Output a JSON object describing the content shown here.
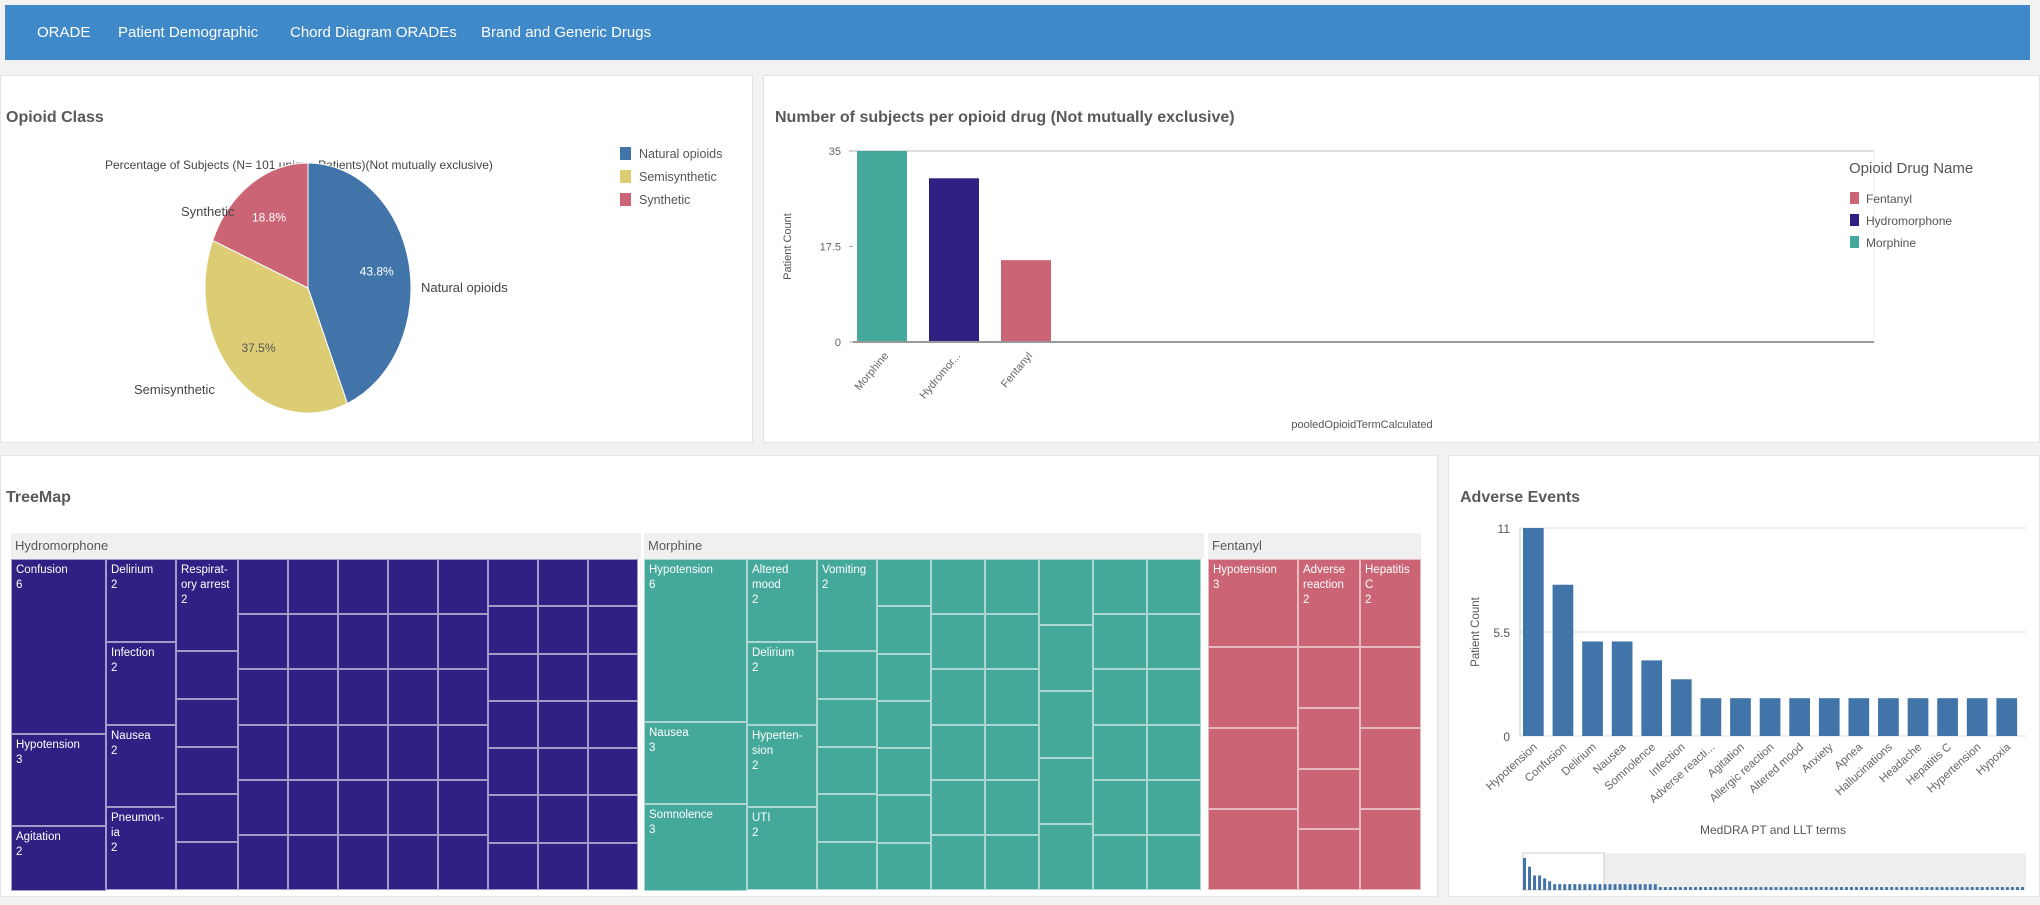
{
  "nav": {
    "tabs": [
      "ORADE",
      "Patient Demographic",
      "Chord Diagram ORADEs",
      "Brand and Generic Drugs"
    ],
    "color": "#3f89c9"
  },
  "opioid_class": {
    "title": "Opioid Class",
    "chart_data": {
      "type": "pie",
      "subtitle": "Percentage of Subjects (N= 101 unique Patients)(Not mutually exclusive)",
      "slices": [
        {
          "label": "Natural opioids",
          "value": 43.8,
          "display": "43.8%",
          "color": "#4174a8"
        },
        {
          "label": "Semisynthetic",
          "value": 37.5,
          "display": "37.5%",
          "color": "#dccd75"
        },
        {
          "label": "Synthetic",
          "value": 18.8,
          "display": "18.8%",
          "color": "#cb6474"
        }
      ],
      "legend": [
        "Natural opioids",
        "Semisynthetic",
        "Synthetic"
      ],
      "legend_placement": "right"
    }
  },
  "drug_chart": {
    "title": "Number of subjects per opioid drug (Not mutually exclusive)",
    "chart_data": {
      "type": "bar",
      "categories": [
        "Morphine",
        "Hydromor...",
        "Fentanyl"
      ],
      "values": [
        35,
        30,
        15
      ],
      "colors": [
        "#44a99a",
        "#312083",
        "#cb6474"
      ],
      "xlabel": "pooledOpioidTermCalculated",
      "ylabel": "Patient Count",
      "yticks": [
        "0",
        "17.5",
        "35"
      ],
      "ylim": [
        0,
        35
      ],
      "legend_title": "Opioid Drug Name",
      "legend": [
        {
          "name": "Fentanyl",
          "color": "#cb6474"
        },
        {
          "name": "Hydromorphone",
          "color": "#312083"
        },
        {
          "name": "Morphine",
          "color": "#44a99a"
        }
      ],
      "legend_placement": "right"
    }
  },
  "treemap": {
    "title": "TreeMap",
    "groups": [
      {
        "name": "Hydromorphone",
        "color": "#312083",
        "cells": [
          {
            "label": "Confusion",
            "value": "6"
          },
          {
            "label": "Hypotension",
            "value": "3"
          },
          {
            "label": "Agitation",
            "value": "2"
          },
          {
            "label": "Delirium",
            "value": "2"
          },
          {
            "label": "Infection",
            "value": "2"
          },
          {
            "label": "Nausea",
            "value": "2"
          },
          {
            "label": "Pneumon-ia",
            "value": "2"
          },
          {
            "label": "Respirat-ory arrest",
            "value": "2"
          }
        ]
      },
      {
        "name": "Morphine",
        "color": "#44a99a",
        "cells": [
          {
            "label": "Hypotension",
            "value": "6"
          },
          {
            "label": "Nausea",
            "value": "3"
          },
          {
            "label": "Somnolence",
            "value": "3"
          },
          {
            "label": "Altered mood",
            "value": "2"
          },
          {
            "label": "Delirium",
            "value": "2"
          },
          {
            "label": "Hyperten-sion",
            "value": "2"
          },
          {
            "label": "UTI",
            "value": "2"
          },
          {
            "label": "Vomiting",
            "value": "2"
          }
        ]
      },
      {
        "name": "Fentanyl",
        "color": "#cb6474",
        "cells": [
          {
            "label": "Hypotension",
            "value": "3"
          },
          {
            "label": "Adverse reaction",
            "value": "2"
          },
          {
            "label": "Hepatitis C",
            "value": "2"
          }
        ]
      }
    ]
  },
  "adverse_events": {
    "title": "Adverse Events",
    "chart_data": {
      "type": "bar",
      "categories": [
        "Hypotension",
        "Confusion",
        "Delirium",
        "Nausea",
        "Somnolence",
        "Infection",
        "Adverse reacti...",
        "Agitation",
        "Allergic reaction",
        "Altered mood",
        "Anxiety",
        "Apnea",
        "Hallucinations",
        "Headache",
        "Hepatitis C",
        "Hypertension",
        "Hypoxia"
      ],
      "values": [
        11,
        8,
        5,
        5,
        4,
        3,
        2,
        2,
        2,
        2,
        2,
        2,
        2,
        2,
        2,
        2,
        2
      ],
      "color": "#4174a8",
      "xlabel": "MedDRA PT and LLT terms",
      "ylabel": "Patient Count",
      "yticks": [
        "0",
        "5.5",
        "11"
      ],
      "ylim": [
        0,
        11
      ],
      "grid": true
    }
  }
}
